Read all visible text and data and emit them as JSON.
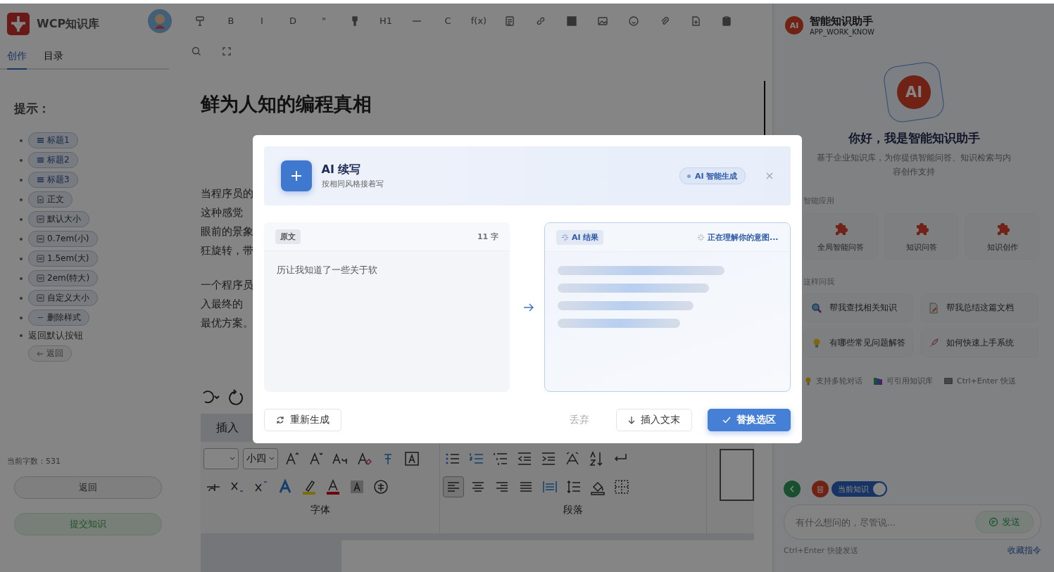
{
  "app": {
    "name": "WCP知识库"
  },
  "toolbar": [
    {
      "kind": "icon"
    },
    {
      "kind": "text",
      "label": "B"
    },
    {
      "kind": "text",
      "label": "I"
    },
    {
      "kind": "text",
      "label": "D"
    },
    {
      "kind": "text",
      "label": "\""
    },
    {
      "kind": "icon"
    },
    {
      "kind": "text",
      "label": "H1"
    },
    {
      "kind": "icon"
    },
    {
      "kind": "text",
      "label": "C"
    },
    {
      "kind": "text",
      "label": "f(x)"
    },
    {
      "kind": "icon"
    },
    {
      "kind": "icon"
    },
    {
      "kind": "icon"
    },
    {
      "kind": "icon"
    },
    {
      "kind": "icon"
    },
    {
      "kind": "icon"
    },
    {
      "kind": "icon"
    },
    {
      "kind": "icon"
    }
  ],
  "side_tabs": [
    {
      "label": "创作",
      "selected": true
    },
    {
      "label": "目录",
      "selected": false
    }
  ],
  "hints": {
    "title": "提示：",
    "items": [
      {
        "kind": "heading",
        "label": "标题1"
      },
      {
        "kind": "heading",
        "label": "标题2"
      },
      {
        "kind": "heading",
        "label": "标题3"
      },
      {
        "kind": "body",
        "label": "正文"
      },
      {
        "kind": "size",
        "label": "默认大小"
      },
      {
        "kind": "size",
        "label": "0.7em(小)"
      },
      {
        "kind": "size",
        "label": "1.5em(大)"
      },
      {
        "kind": "size",
        "label": "2em(特大)"
      },
      {
        "kind": "size",
        "label": "自定义大小"
      },
      {
        "kind": "clear",
        "label": "删除样式"
      }
    ],
    "reset_label": "返回默认按钮",
    "reset_button": "返回"
  },
  "word_count": "当前字数：531",
  "side_buttons": {
    "back": "返回",
    "submit": "提交知识"
  },
  "editor": {
    "title": "鲜为人知的编程真相",
    "paragraphs": [
      [
        "当程序员的",
        "这种感觉",
        "眼前的景象",
        "狂旋转，带"
      ],
      [
        "一个程序员",
        "入最终的",
        "最优方案。"
      ]
    ]
  },
  "ribbon": {
    "tab": "插入",
    "font_size": "小四",
    "groups": [
      "字体",
      "段落"
    ]
  },
  "modal": {
    "title": "AI 续写",
    "subtitle": "按相同风格接着写",
    "badge": "AI 智能生成",
    "source": {
      "tag": "原文",
      "count": "11 字",
      "text": "历让我知道了一些关于软"
    },
    "result": {
      "tag": "AI 结果",
      "status": "正在理解你的意图..."
    },
    "actions": {
      "regenerate": "重新生成",
      "discard": "丢弃",
      "insert": "插入文末",
      "replace": "替换选区"
    }
  },
  "assistant": {
    "logo": "AI",
    "title": "智能知识助手",
    "subtitle": "APP_WORK_KNOW",
    "hero_logo": "AI",
    "greeting": "你好，我是智能知识助手",
    "description": "基于企业知识库，为你提供智能问答、知识检索与内容创作支持",
    "apps_label": "智能应用",
    "apps": [
      "全局智能问答",
      "知识问答",
      "知识创作"
    ],
    "ask_label": "这样问我",
    "suggestions": [
      "帮我查找相关知识",
      "帮我总结这篇文档",
      "有哪些常见问题解答",
      "如何快速上手系统"
    ],
    "features": [
      "支持多轮对话",
      "可引用知识库",
      "Ctrl+Enter 快送"
    ],
    "toggle": {
      "label": "当前知识",
      "on": true
    },
    "input": {
      "placeholder": "有什么想问的，尽管说..."
    },
    "send": "发送",
    "hint": "Ctrl+Enter 快捷发送",
    "favorites": "收藏指令"
  }
}
